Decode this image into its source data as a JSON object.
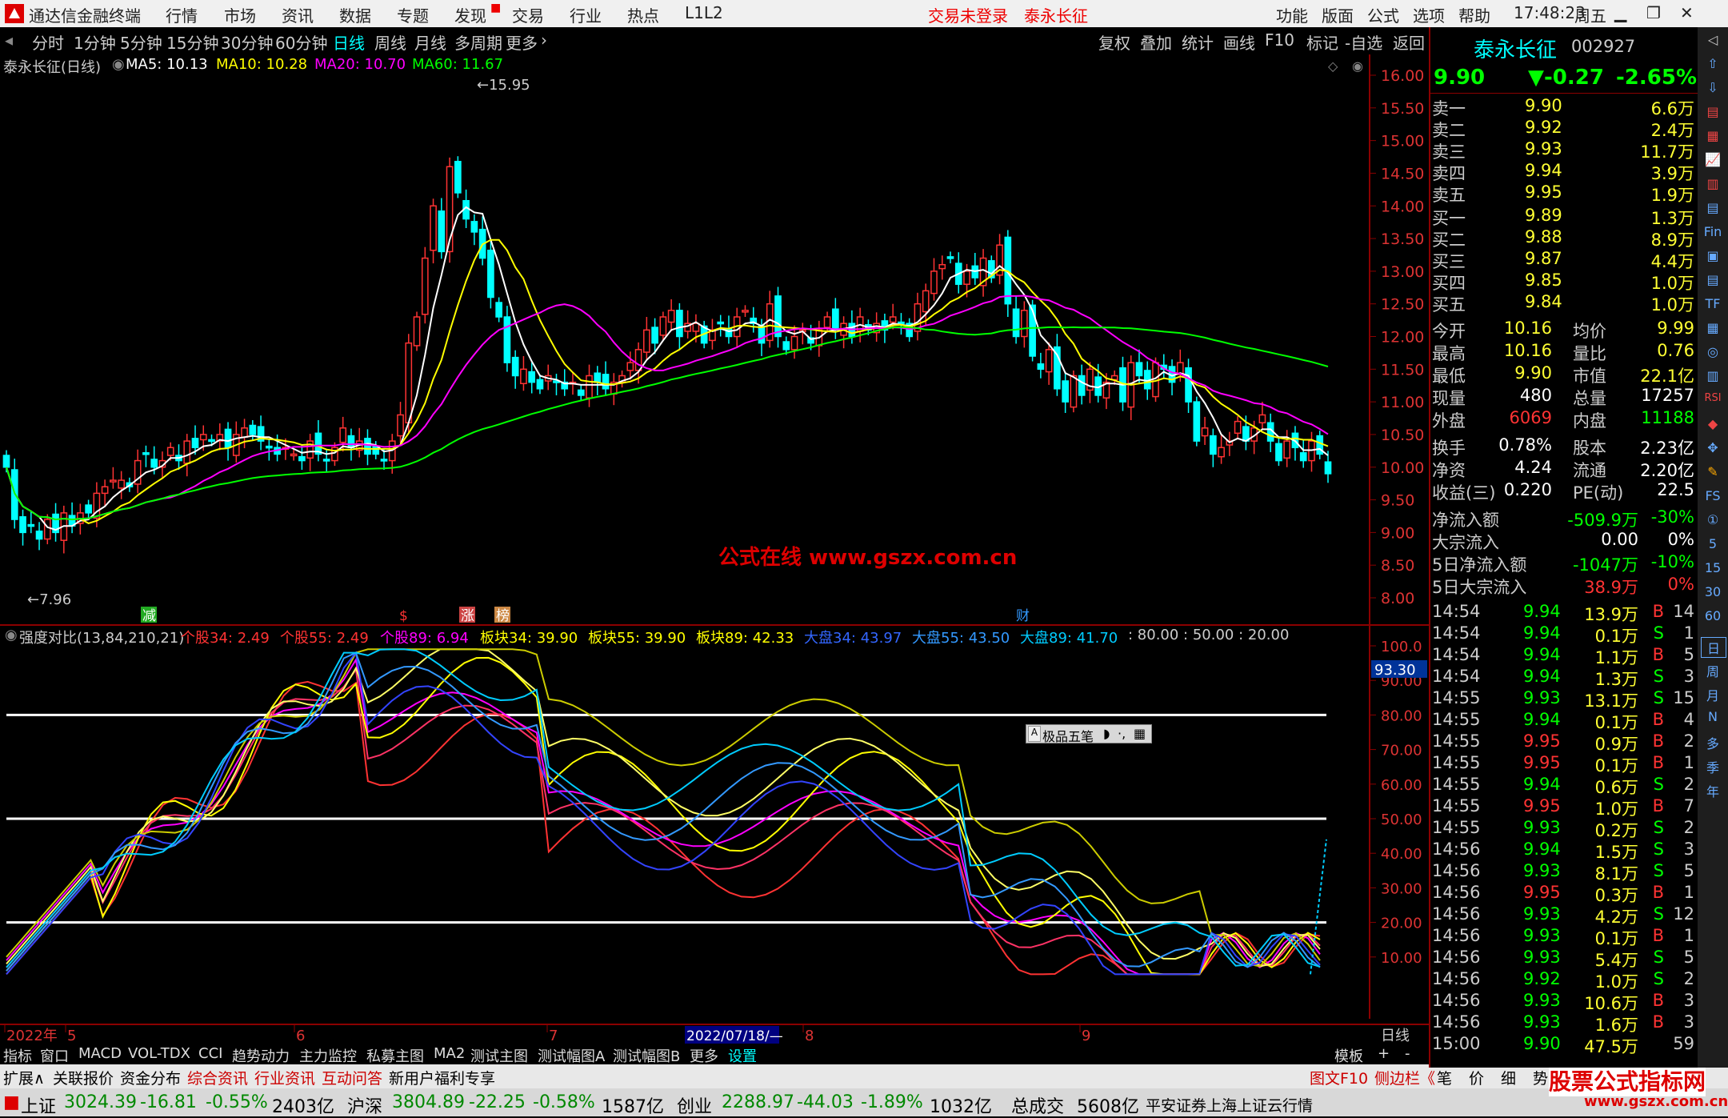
{
  "titlebar": {
    "app": "通达信金融终端",
    "menus": [
      "行情",
      "市场",
      "资讯",
      "数据",
      "专题",
      "发现",
      "交易",
      "行业",
      "热点",
      "L1L2"
    ],
    "notice": "交易未登录",
    "stock": "泰永长征",
    "right_menus": [
      "功能",
      "版面",
      "公式",
      "选项",
      "帮助"
    ],
    "time": "17:48:23",
    "weekday": "周五"
  },
  "periods": [
    "分时",
    "1分钟",
    "5分钟",
    "15分钟",
    "30分钟",
    "60分钟",
    "日线",
    "周线",
    "月线",
    "多周期",
    "更多"
  ],
  "active_period": "日线",
  "tools": [
    "复权",
    "叠加",
    "统计",
    "画线",
    "F10",
    "标记",
    "-自选",
    "返回"
  ],
  "chart_header": {
    "name": "泰永长征(日线)",
    "ma": [
      {
        "label": "MA5: 10.13",
        "color": "#ffffff"
      },
      {
        "label": "MA10: 10.28",
        "color": "#ffff00"
      },
      {
        "label": "MA20: 10.70",
        "color": "#ff00ff"
      },
      {
        "label": "MA60: 11.67",
        "color": "#00ff00"
      }
    ]
  },
  "price_axis": [
    "16.00",
    "15.50",
    "15.00",
    "14.50",
    "14.00",
    "13.50",
    "13.00",
    "12.50",
    "12.00",
    "11.50",
    "11.00",
    "10.50",
    "10.00",
    "9.50",
    "9.00",
    "8.50",
    "8.00"
  ],
  "annotations": {
    "high": "15.95",
    "low": "7.96",
    "watermark": "公式在线  www.gszx.com.cn",
    "markers": [
      "减",
      "$",
      "涨",
      "榜",
      "财"
    ]
  },
  "indicator": {
    "title": "强度对比(13,84,210,21)",
    "legend": [
      {
        "label": "个股34: 2.49",
        "color": "#ff3333"
      },
      {
        "label": "个股55: 2.49",
        "color": "#ff3333"
      },
      {
        "label": "个股89: 6.94",
        "color": "#ff00ff"
      },
      {
        "label": "板块34: 39.90",
        "color": "#ffff00"
      },
      {
        "label": "板块55: 39.90",
        "color": "#ffff00"
      },
      {
        "label": "板块89: 42.33",
        "color": "#ffff00"
      },
      {
        "label": "大盘34: 43.97",
        "color": "#3366ff"
      },
      {
        "label": "大盘55: 43.50",
        "color": "#3399ff"
      },
      {
        "label": "大盘89: 41.70",
        "color": "#00ccff"
      },
      {
        "label": ": 80.00 : 50.00 : 20.00",
        "color": "#cccccc"
      }
    ],
    "axis": [
      "100.0",
      "90.00",
      "80.00",
      "70.00",
      "60.00",
      "50.00",
      "40.00",
      "30.00",
      "20.00",
      "10.00"
    ],
    "current_value": "93.30",
    "popup": "极品五笔"
  },
  "date_axis": {
    "labels": [
      "2022年",
      "5",
      "6",
      "7",
      "8",
      "9"
    ],
    "cursor_date": "2022/07/18/—",
    "right_label": "日线"
  },
  "bottom_tabs": [
    "指标",
    "窗口",
    "MACD",
    "VOL-TDX",
    "CCI",
    "趋势动力",
    "主力监控",
    "私募主图",
    "MA2",
    "测试主图",
    "测试幅图A",
    "测试幅图B",
    "更多",
    "设置"
  ],
  "bottom_tabs_right": [
    "模板",
    "+",
    "-"
  ],
  "tabs2": [
    "扩展∧",
    "关联报价",
    "资金分布",
    "综合资讯",
    "行业资讯",
    "互动问答",
    "新用户福利专享"
  ],
  "tabs2_right": [
    "图文F10",
    "侧边栏《",
    "笔",
    "价",
    "细",
    "势"
  ],
  "quote": {
    "name": "泰永长征",
    "code": "002927",
    "price": "9.90",
    "change": "▼-0.27",
    "pct": "-2.65%",
    "sell": [
      {
        "label": "卖五",
        "price": "9.95",
        "vol": "1.9万"
      },
      {
        "label": "卖四",
        "price": "9.94",
        "vol": "3.9万"
      },
      {
        "label": "卖三",
        "price": "9.93",
        "vol": "11.7万"
      },
      {
        "label": "卖二",
        "price": "9.92",
        "vol": "2.4万"
      },
      {
        "label": "卖一",
        "price": "9.90",
        "vol": "6.6万"
      }
    ],
    "buy": [
      {
        "label": "买一",
        "price": "9.89",
        "vol": "1.3万"
      },
      {
        "label": "买二",
        "price": "9.88",
        "vol": "8.9万"
      },
      {
        "label": "买三",
        "price": "9.87",
        "vol": "4.4万"
      },
      {
        "label": "买四",
        "price": "9.85",
        "vol": "1.0万"
      },
      {
        "label": "买五",
        "price": "9.84",
        "vol": "1.0万"
      }
    ],
    "stats": [
      [
        "今开",
        "10.16",
        "均价",
        "9.99"
      ],
      [
        "最高",
        "10.16",
        "量比",
        "0.76"
      ],
      [
        "最低",
        "9.90",
        "市值",
        "22.1亿"
      ],
      [
        "现量",
        "480",
        "总量",
        "17257"
      ],
      [
        "外盘",
        "6069",
        "内盘",
        "11188"
      ]
    ],
    "stats2": [
      [
        "换手",
        "0.78%",
        "股本",
        "2.23亿"
      ],
      [
        "净资",
        "4.24",
        "流通",
        "2.20亿"
      ],
      [
        "收益(三)",
        "0.220",
        "PE(动)",
        "22.5"
      ]
    ],
    "flows": [
      {
        "label": "净流入额",
        "val": "-509.9万",
        "pct": "-30%"
      },
      {
        "label": "大宗流入",
        "val": "0.00",
        "pct": "0%"
      },
      {
        "label": "5日净流入额",
        "val": "-1047万",
        "pct": "-10%"
      },
      {
        "label": "5日大宗流入",
        "val": "38.9万",
        "pct": "0%"
      }
    ],
    "ticks": [
      [
        "14:54",
        "9.94",
        "13.9万",
        "B",
        "14"
      ],
      [
        "14:54",
        "9.94",
        "0.1万",
        "S",
        "1"
      ],
      [
        "14:54",
        "9.94",
        "1.1万",
        "B",
        "5"
      ],
      [
        "14:54",
        "9.94",
        "1.3万",
        "S",
        "3"
      ],
      [
        "14:55",
        "9.93",
        "13.1万",
        "S",
        "15"
      ],
      [
        "14:55",
        "9.94",
        "0.1万",
        "B",
        "4"
      ],
      [
        "14:55",
        "9.95",
        "0.9万",
        "B",
        "2"
      ],
      [
        "14:55",
        "9.95",
        "0.1万",
        "B",
        "1"
      ],
      [
        "14:55",
        "9.94",
        "0.6万",
        "S",
        "2"
      ],
      [
        "14:55",
        "9.95",
        "1.0万",
        "B",
        "7"
      ],
      [
        "14:55",
        "9.93",
        "0.2万",
        "S",
        "2"
      ],
      [
        "14:56",
        "9.94",
        "1.5万",
        "S",
        "3"
      ],
      [
        "14:56",
        "9.93",
        "8.1万",
        "S",
        "5"
      ],
      [
        "14:56",
        "9.95",
        "0.3万",
        "B",
        "1"
      ],
      [
        "14:56",
        "9.93",
        "4.2万",
        "S",
        "12"
      ],
      [
        "14:56",
        "9.93",
        "0.1万",
        "B",
        "1"
      ],
      [
        "14:56",
        "9.93",
        "5.4万",
        "S",
        "5"
      ],
      [
        "14:56",
        "9.92",
        "1.0万",
        "S",
        "2"
      ],
      [
        "14:56",
        "9.93",
        "10.6万",
        "B",
        "3"
      ],
      [
        "14:56",
        "9.93",
        "1.6万",
        "B",
        "3"
      ],
      [
        "15:00",
        "9.90",
        "47.5万",
        "",
        "59"
      ]
    ]
  },
  "statusbar": [
    {
      "name": "上证",
      "val": "3024.39",
      "chg": "-16.81",
      "pct": "-0.55%",
      "amt": "2403亿"
    },
    {
      "name": "沪深",
      "val": "3804.89",
      "chg": "-22.25",
      "pct": "-0.58%",
      "amt": "1587亿"
    },
    {
      "name": "创业",
      "val": "2288.97",
      "chg": "-44.03",
      "pct": "-1.89%",
      "amt": "1032亿"
    }
  ],
  "status_total_label": "总成交",
  "status_total": "5608亿",
  "status_source": "平安证券上海上证云行情",
  "logo": "股票公式指标网",
  "logo_url": "www.gszx.com.cn",
  "colors": {
    "up": "#ff3333",
    "down": "#00ffff",
    "ma5": "#ffffff",
    "ma10": "#ffff00",
    "ma20": "#ff00ff",
    "ma60": "#00ff00",
    "panel_border": "#8b0000"
  }
}
